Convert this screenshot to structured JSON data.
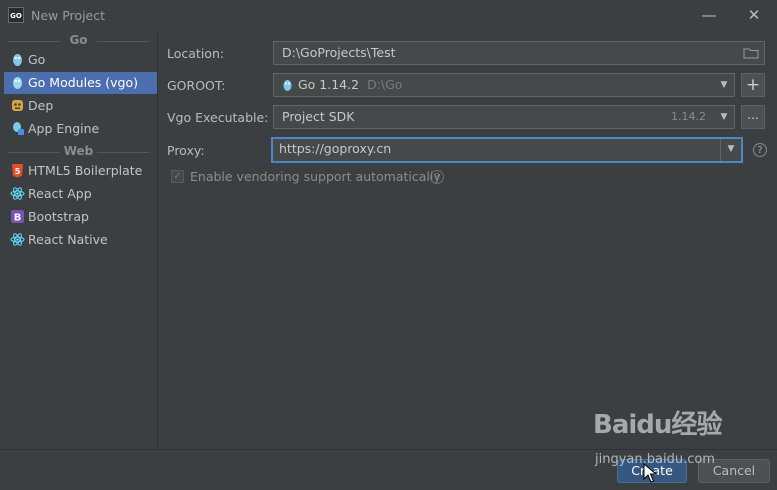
{
  "window": {
    "title": "New Project",
    "logo_text": "GO",
    "minimize_label": "—",
    "close_label": "✕"
  },
  "sidebar": {
    "groups": [
      {
        "header": "Go",
        "items": [
          {
            "label": "Go",
            "icon": "gopher-icon",
            "selected": false
          },
          {
            "label": "Go Modules (vgo)",
            "icon": "gopher-icon",
            "selected": true
          },
          {
            "label": "Dep",
            "icon": "dep-icon",
            "selected": false
          },
          {
            "label": "App Engine",
            "icon": "app-engine-icon",
            "selected": false
          }
        ]
      },
      {
        "header": "Web",
        "items": [
          {
            "label": "HTML5 Boilerplate",
            "icon": "html5-icon",
            "selected": false
          },
          {
            "label": "React App",
            "icon": "react-icon",
            "selected": false
          },
          {
            "label": "Bootstrap",
            "icon": "bootstrap-icon",
            "selected": false
          },
          {
            "label": "React Native",
            "icon": "react-icon",
            "selected": false
          }
        ]
      }
    ]
  },
  "form": {
    "location": {
      "label": "Location:",
      "value": "D:\\GoProjects\\Test"
    },
    "goroot": {
      "label": "GOROOT:",
      "value": "Go 1.14.2",
      "path": "D:\\Go",
      "add_label": "+"
    },
    "vgo": {
      "label": "Vgo Executable:",
      "value": "Project SDK",
      "version": "1.14.2",
      "browse_label": "..."
    },
    "proxy": {
      "label": "Proxy:",
      "value": "https://goproxy.cn",
      "help": "?"
    },
    "vendoring": {
      "label": "Enable vendoring support automatically",
      "checked": true,
      "help": "?"
    }
  },
  "footer": {
    "create_label": "Create",
    "cancel_label": "Cancel"
  },
  "watermark": {
    "brand": "Baidu经验",
    "url": "jingyan.baidu.com"
  },
  "colors": {
    "background": "#3c3f41",
    "selection": "#4b6eaf",
    "focus_border": "#4a88c7",
    "field_bg": "#45494a",
    "primary_button": "#365880"
  }
}
